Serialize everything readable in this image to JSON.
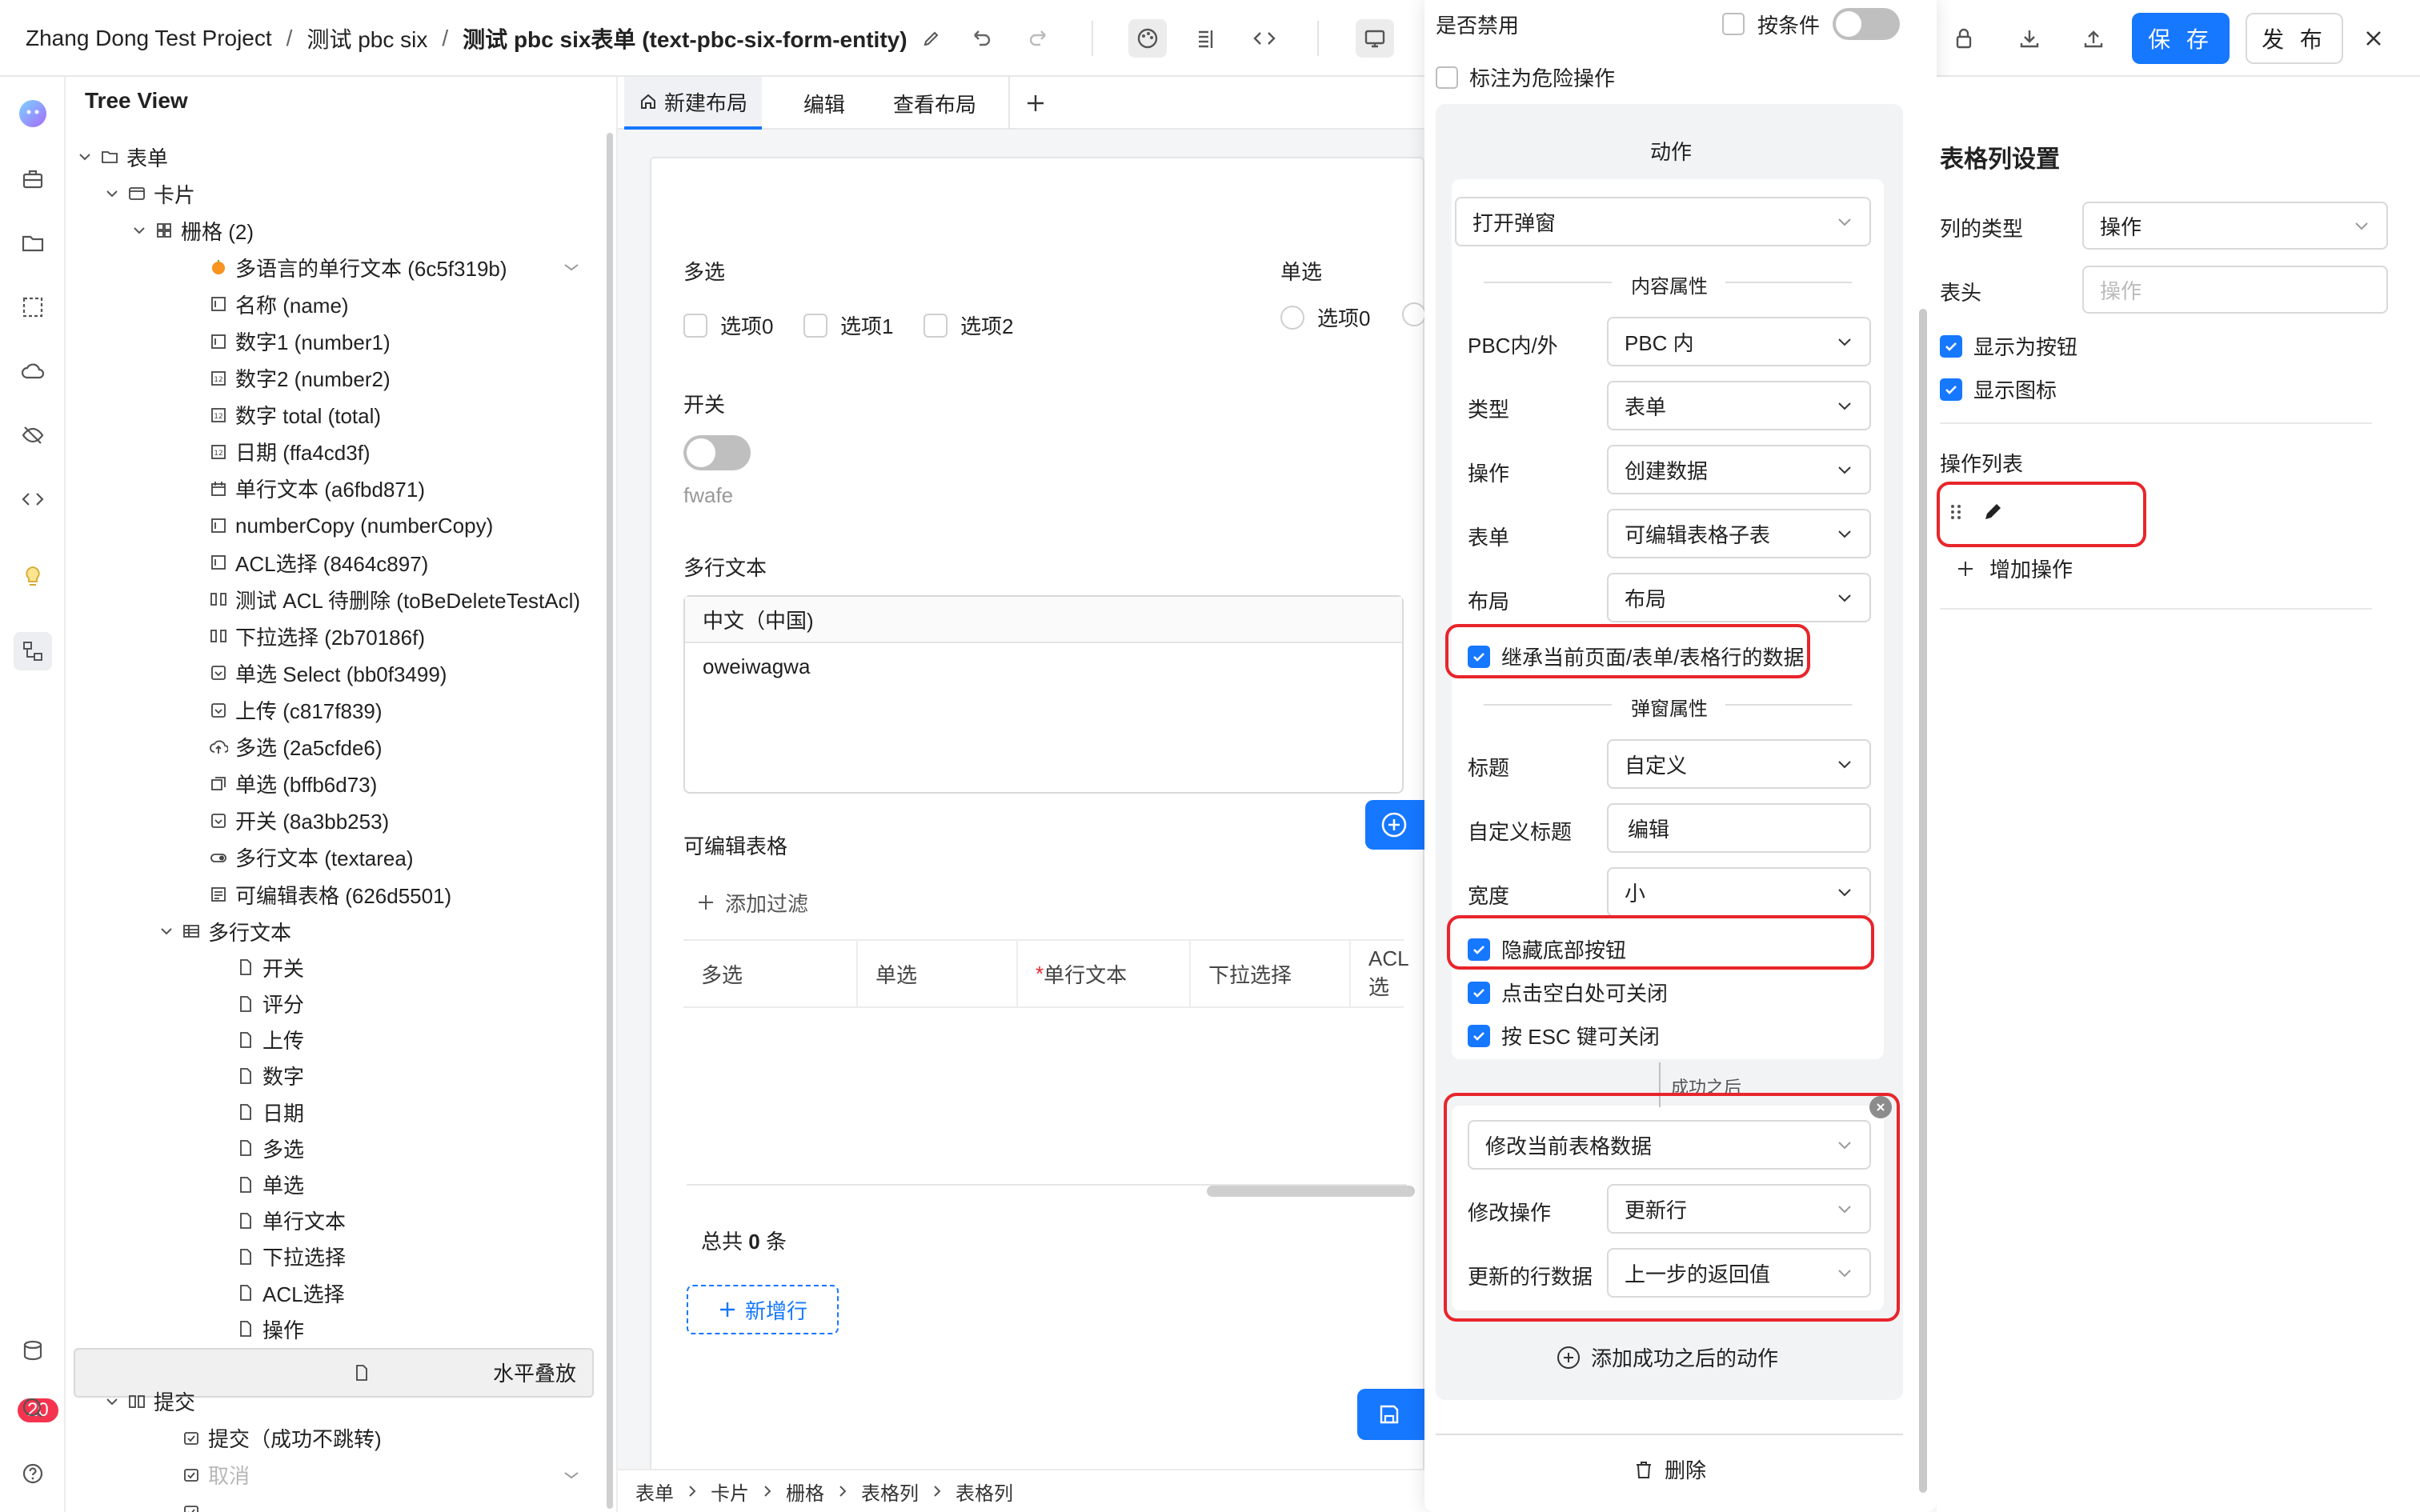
{
  "breadcrumb": {
    "project": "Zhang Dong Test Project",
    "app": "测试 pbc six",
    "page": "测试 pbc six表单 (text-pbc-six-form-entity)"
  },
  "toolbar": {
    "save": "保 存",
    "publish": "发 布"
  },
  "rail": {
    "badge": "20"
  },
  "tree": {
    "title": "Tree View",
    "nodes": [
      "表单",
      "卡片",
      "栅格 (2)",
      "多语言的单行文本 (6c5f319b)",
      "名称 (name)",
      "数字1 (number1)",
      "数字2 (number2)",
      "数字 total (total)",
      "日期 (ffa4cd3f)",
      "单行文本 (a6fbd871)",
      "numberCopy (numberCopy)",
      "ACL选择 (8464c897)",
      "测试 ACL 待删除 (toBeDeleteTestAcl)",
      "下拉选择 (2b70186f)",
      "单选 Select (bb0f3499)",
      "上传 (c817f839)",
      "多选 (2a5cfde6)",
      "单选 (bffb6d73)",
      "开关 (8a3bb253)",
      "多行文本 (textarea)",
      "可编辑表格 (626d5501)",
      "多行文本",
      "开关",
      "评分",
      "上传",
      "数字",
      "日期",
      "多选",
      "单选",
      "单行文本",
      "下拉选择",
      "ACL选择",
      "操作",
      "水平叠放",
      "提交",
      "提交（成功不跳转)",
      "取消"
    ]
  },
  "tabs": [
    "新建布局",
    "编辑",
    "查看布局"
  ],
  "form": {
    "multi_label": "多选",
    "multi_options": [
      "选项0",
      "选项1",
      "选项2"
    ],
    "single_label": "单选",
    "single_options": [
      "选项0"
    ],
    "switch_label": "开关",
    "switch_text": "fwafe",
    "textarea_label": "多行文本",
    "textarea_lang": "中文（中国)",
    "textarea_value": "oweiwagwa",
    "table_label": "可编辑表格",
    "filter": "添加过滤",
    "columns": [
      "多选",
      "单选",
      "单行文本",
      "下拉选择",
      "ACL选"
    ],
    "total_prefix": "总共",
    "total_count": "0",
    "total_suffix": "条",
    "add_row": "新增行"
  },
  "bottom_crumbs": [
    "表单",
    "卡片",
    "栅格",
    "表格列",
    "表格列"
  ],
  "panel": {
    "disabled_label": "是否禁用",
    "conditional_label": "按条件",
    "danger_label": "标注为危险操作",
    "action_title": "动作",
    "action_select": "打开弹窗",
    "content_props": "内容属性",
    "pbc_label": "PBC内/外",
    "pbc_value": "PBC 内",
    "type_label": "类型",
    "type_value": "表单",
    "op_label": "操作",
    "op_value": "创建数据",
    "form_label": "表单",
    "form_value": "可编辑表格子表",
    "layout_label": "布局",
    "layout_value": "布局",
    "inherit_label": "继承当前页面/表单/表格行的数据",
    "modal_props": "弹窗属性",
    "title_label": "标题",
    "title_value": "自定义",
    "custom_title_label": "自定义标题",
    "custom_title_value": "编辑",
    "width_label": "宽度",
    "width_value": "小",
    "hide_footer": "隐藏底部按钮",
    "click_close": "点击空白处可关闭",
    "esc_close": "按 ESC 键可关闭",
    "after_success": "成功之后",
    "after_action": "修改当前表格数据",
    "modify_op_label": "修改操作",
    "modify_op_value": "更新行",
    "row_data_label": "更新的行数据",
    "row_data_value": "上一步的返回值",
    "add_after": "添加成功之后的动作",
    "delete": "删除"
  },
  "settings": {
    "title": "表格列设置",
    "col_type_label": "列的类型",
    "col_type_value": "操作",
    "header_label": "表头",
    "header_placeholder": "操作",
    "show_as_button": "显示为按钮",
    "show_icon": "显示图标",
    "ops_list": "操作列表",
    "add_op": "增加操作"
  },
  "colors": {
    "primary": "#1677ff",
    "highlight": "#e8252b"
  }
}
